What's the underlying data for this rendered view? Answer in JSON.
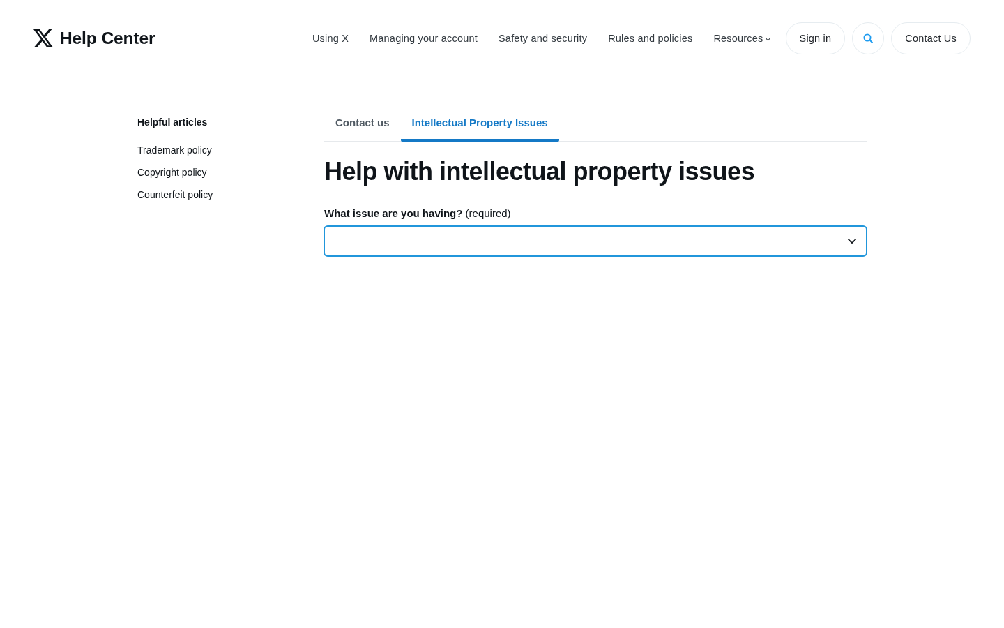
{
  "header": {
    "logo": {
      "text": "Help Center"
    },
    "nav": [
      {
        "label": "Using X",
        "kind": "link"
      },
      {
        "label": "Managing your account",
        "kind": "link"
      },
      {
        "label": "Safety and security",
        "kind": "link"
      },
      {
        "label": "Rules and policies",
        "kind": "link"
      },
      {
        "label": "Resources",
        "kind": "dropdown"
      }
    ],
    "actions": [
      {
        "kind": "text",
        "label": "Sign in"
      },
      {
        "kind": "search"
      },
      {
        "kind": "text",
        "label": "Contact Us"
      }
    ]
  },
  "sidebar": {
    "title": "Helpful articles",
    "items": [
      "Trademark policy",
      "Copyright policy",
      "Counterfeit policy"
    ]
  },
  "tabs": [
    {
      "label": "Contact us",
      "selected": false
    },
    {
      "label": "Intellectual Property Issues",
      "selected": true
    }
  ],
  "heading": "Help with intellectual property issues",
  "form": {
    "field": {
      "label": "**What issue are you having?** (required)",
      "focused": true
    }
  }
}
